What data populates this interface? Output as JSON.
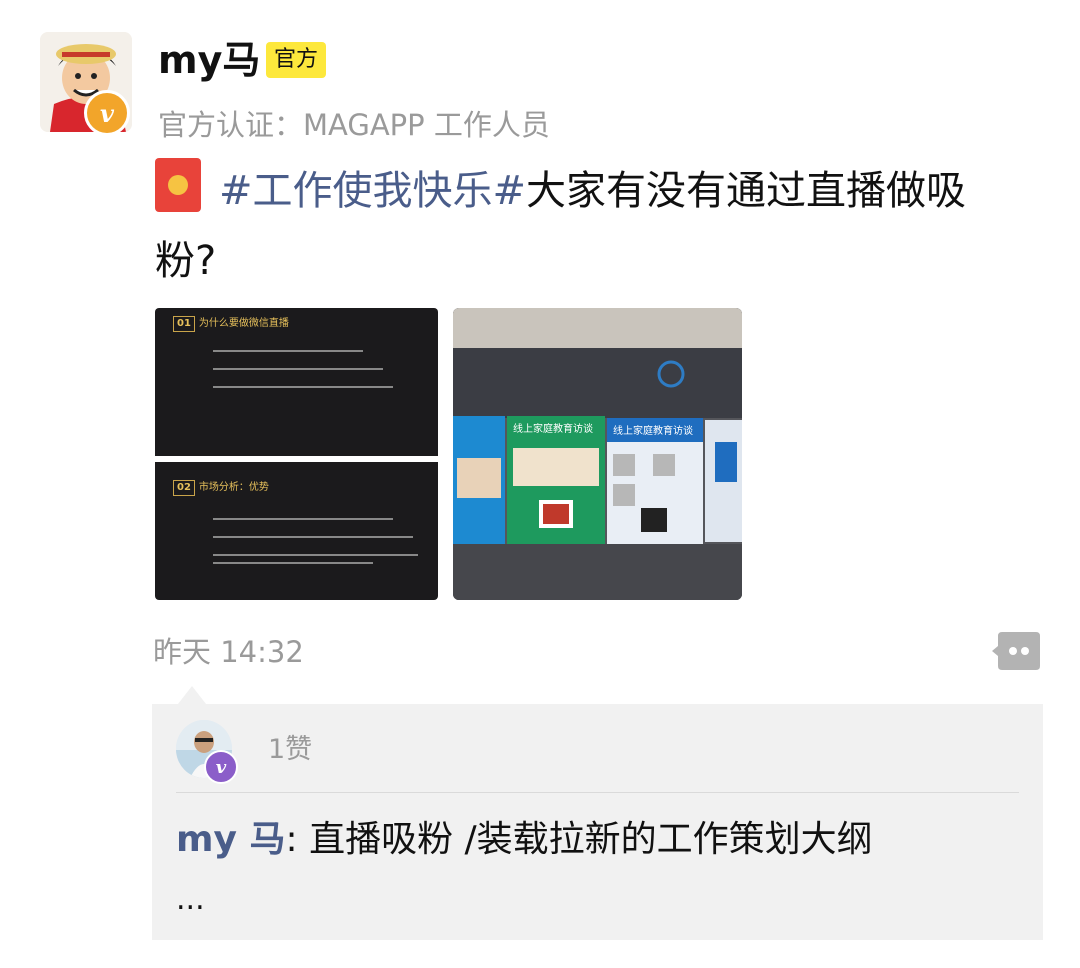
{
  "post": {
    "username": "my马",
    "official_tag": "官方",
    "certification": "官方认证：MAGAPP 工作人员",
    "hashtag": "#工作使我快乐#",
    "text": "大家有没有通过直播做吸粉?",
    "time": "昨天 14:32"
  },
  "images": [
    {
      "slides": [
        {
          "number": "01",
          "heading": "为什么要做微信直播"
        },
        {
          "number": "02",
          "heading": "市场分析：优势"
        }
      ]
    },
    {
      "screen_headings": [
        "线上家庭教育访谈",
        "线上家庭教育访谈"
      ]
    }
  ],
  "likes": {
    "count": "1赞"
  },
  "comment": {
    "author": "my 马",
    "separator": ": ",
    "text": "直播吸粉 /装载拉新的工作策划大纲",
    "more": "..."
  },
  "icons": {
    "avatar_badge": "verified-v-icon",
    "red_packet": "red-packet-icon",
    "comment": "comment-bubble-icon"
  },
  "colors": {
    "hashtag": "#4a5d8a",
    "official_tag_bg": "#fde83c",
    "verify_badge": "#f2a52a",
    "liker_badge": "#8b5ec9",
    "panel_bg": "#f1f1f1"
  }
}
